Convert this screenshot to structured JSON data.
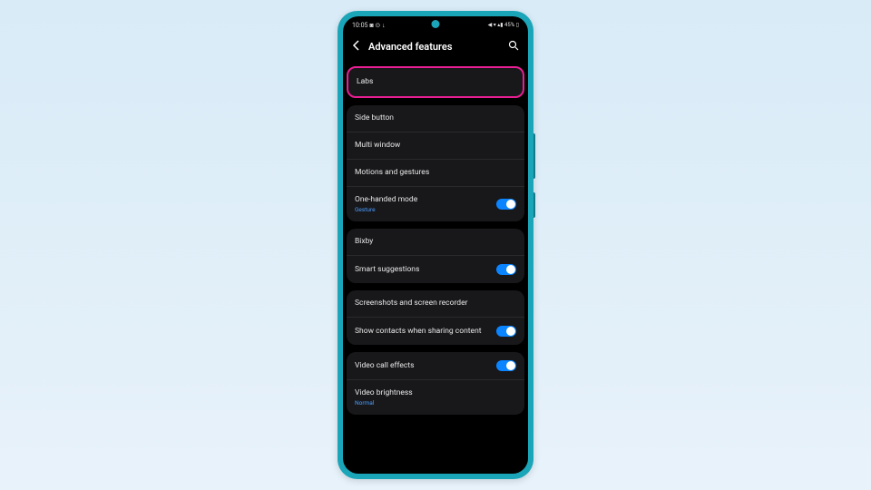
{
  "status": {
    "time": "10:05",
    "icons_left": "◙ ⊙ ↓",
    "icons_right": "◀ ▾ ▴▮ 45% ▯"
  },
  "header": {
    "title": "Advanced features"
  },
  "highlight": {
    "label": "Labs"
  },
  "group1": {
    "side_button": "Side button",
    "multi_window": "Multi window",
    "motions": "Motions and gestures",
    "one_handed": "One-handed mode",
    "one_handed_sub": "Gesture"
  },
  "group2": {
    "bixby": "Bixby",
    "smart": "Smart suggestions"
  },
  "group3": {
    "screenshots": "Screenshots and screen recorder",
    "contacts": "Show contacts when sharing content"
  },
  "group4": {
    "video_call": "Video call effects",
    "video_brightness": "Video brightness",
    "video_brightness_sub": "Normal"
  }
}
